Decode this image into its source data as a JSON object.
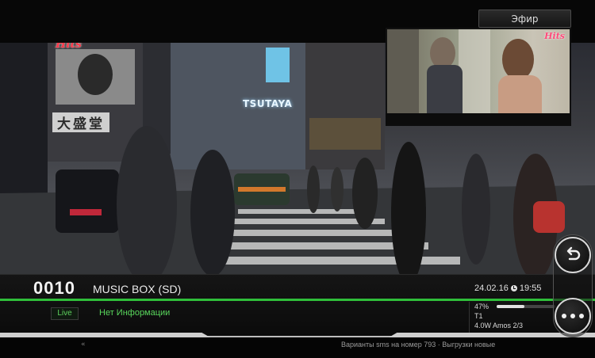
{
  "header": {
    "live_button": "Эфир"
  },
  "video": {
    "channel_logo": "Hits",
    "sign_tsutaya": "TSUTAYA",
    "sign_kanji": "大盛堂",
    "pip_logo": "Hits"
  },
  "info_bar": {
    "channel_number": "0010",
    "channel_name": "MUSIC BOX (SD)",
    "date": "24.02.16",
    "time": "19:55",
    "live_badge": "Live",
    "epg_text": "Нет Информации",
    "signal": {
      "percent_label": "47%",
      "level": 0.47,
      "tuner": "T1",
      "satellite": "4.0W Amos 2/3"
    }
  },
  "ticker": {
    "left": "«",
    "text": "Варианты sms на номер 793 · Выгрузки новые"
  },
  "controls": {
    "back_icon": "back-arrow-icon",
    "more_icon": "more-dots-icon"
  },
  "colors": {
    "accent_green": "#2fbf3a",
    "epg_green": "#59d85c",
    "logo_red": "#ff3a4a"
  }
}
